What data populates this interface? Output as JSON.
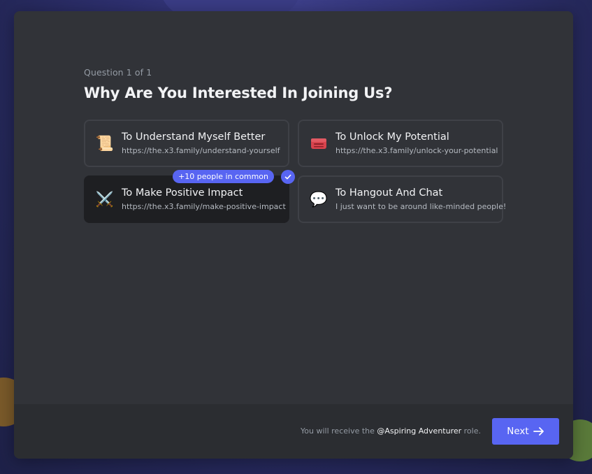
{
  "question": {
    "counter": "Question 1 of 1",
    "title": "Why Are You Interested In Joining Us?"
  },
  "options": [
    {
      "emoji": "📜",
      "emoji_name": "scroll-icon",
      "title": "To Understand Myself Better",
      "description": "https://the.x3.family/understand-yourself",
      "selected": false
    },
    {
      "emoji": "🧰",
      "emoji_name": "toolbox-icon",
      "title": "To Unlock My Potential",
      "description": "https://the.x3.family/unlock-your-potential",
      "selected": false
    },
    {
      "emoji": "⚔️",
      "emoji_name": "crossed-swords-icon",
      "title": "To Make Positive Impact",
      "description": "https://the.x3.family/make-positive-impact",
      "selected": true,
      "badge": "+10 people in common"
    },
    {
      "emoji": "💬",
      "emoji_name": "speech-bubble-icon",
      "title": "To Hangout And Chat",
      "description": "I just want to be around like-minded people!",
      "selected": false
    }
  ],
  "footer": {
    "note_prefix": "You will receive the",
    "role": "@Aspiring Adventurer",
    "note_suffix": "role.",
    "next_label": "Next"
  },
  "colors": {
    "accent": "#5865f2",
    "modal_bg": "#313338",
    "footer_bg": "#2b2d31",
    "selected_bg": "#1e1f22"
  }
}
